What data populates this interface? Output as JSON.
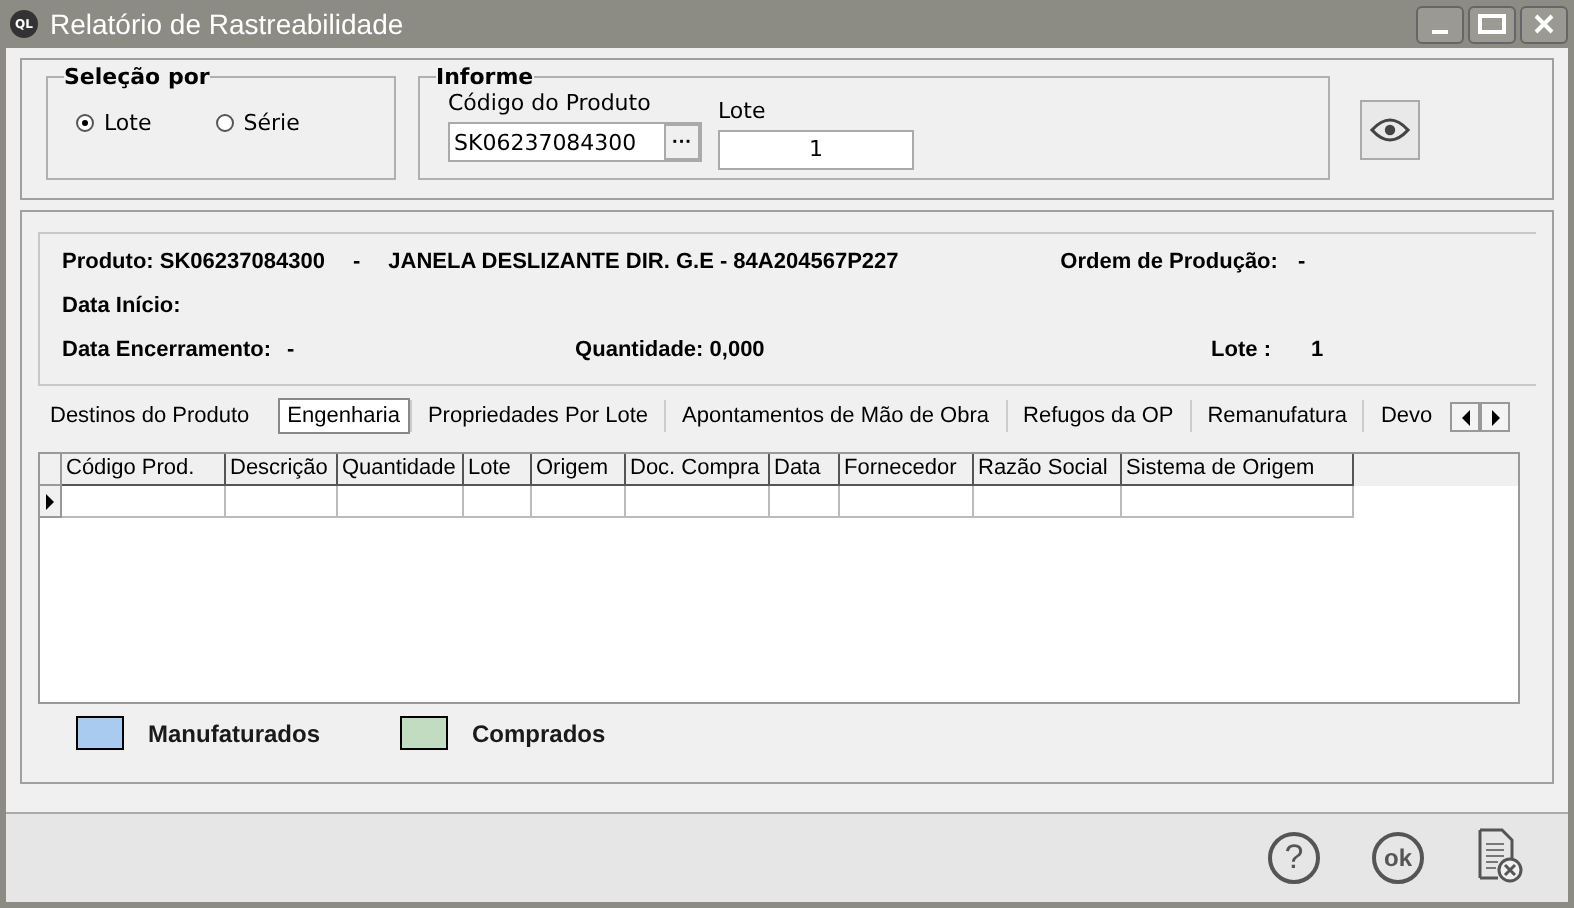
{
  "window": {
    "title": "Relatório de Rastreabilidade",
    "icon_text": "QL"
  },
  "selection": {
    "title": "Seleção por",
    "options": [
      {
        "label": "Lote",
        "selected": true
      },
      {
        "label": "Série",
        "selected": false
      }
    ]
  },
  "informe": {
    "title": "Informe",
    "product_label": "Código do Produto",
    "product_value": "SK06237084300",
    "browse": "···",
    "lot_label": "Lote",
    "lot_value": "1"
  },
  "details": {
    "produto": "**Produto:** **SK06237084300**",
    "dash": "-",
    "descricao": "JANELA DESLIZANTE DIR. G.E - 84A204567P227",
    "ordem_label": "Ordem de Produção:",
    "ordem_value": "-",
    "inicio_label": "Data Início:",
    "encerramento_label": "Data Encerramento:",
    "encerramento_value": "-",
    "quantidade": "Quantidade: 0,000",
    "lote_label": "Lote :",
    "lote_value": "1"
  },
  "tabs": [
    {
      "label": "Destinos do Produto",
      "selected": false
    },
    {
      "label": "Engenharia",
      "selected": true
    },
    {
      "label": "Propriedades Por Lote",
      "selected": false
    },
    {
      "label": "Apontamentos de Mão de Obra",
      "selected": false
    },
    {
      "label": "Refugos da OP",
      "selected": false
    },
    {
      "label": "Remanufatura",
      "selected": false
    },
    {
      "label": "Devo",
      "selected": false
    }
  ],
  "table": {
    "columns": [
      "Código Prod.",
      "Descrição",
      "Quantidade",
      "Lote",
      "Origem",
      "Doc. Compra",
      "Data",
      "Fornecedor",
      "Razão Social",
      "Sistema de Origem"
    ]
  },
  "legend": [
    {
      "label": "Manufaturados",
      "color": "#a9cbef"
    },
    {
      "label": "Comprados",
      "color": "#c2dcc2"
    }
  ],
  "footer": {
    "help": "?",
    "ok": "ok"
  }
}
